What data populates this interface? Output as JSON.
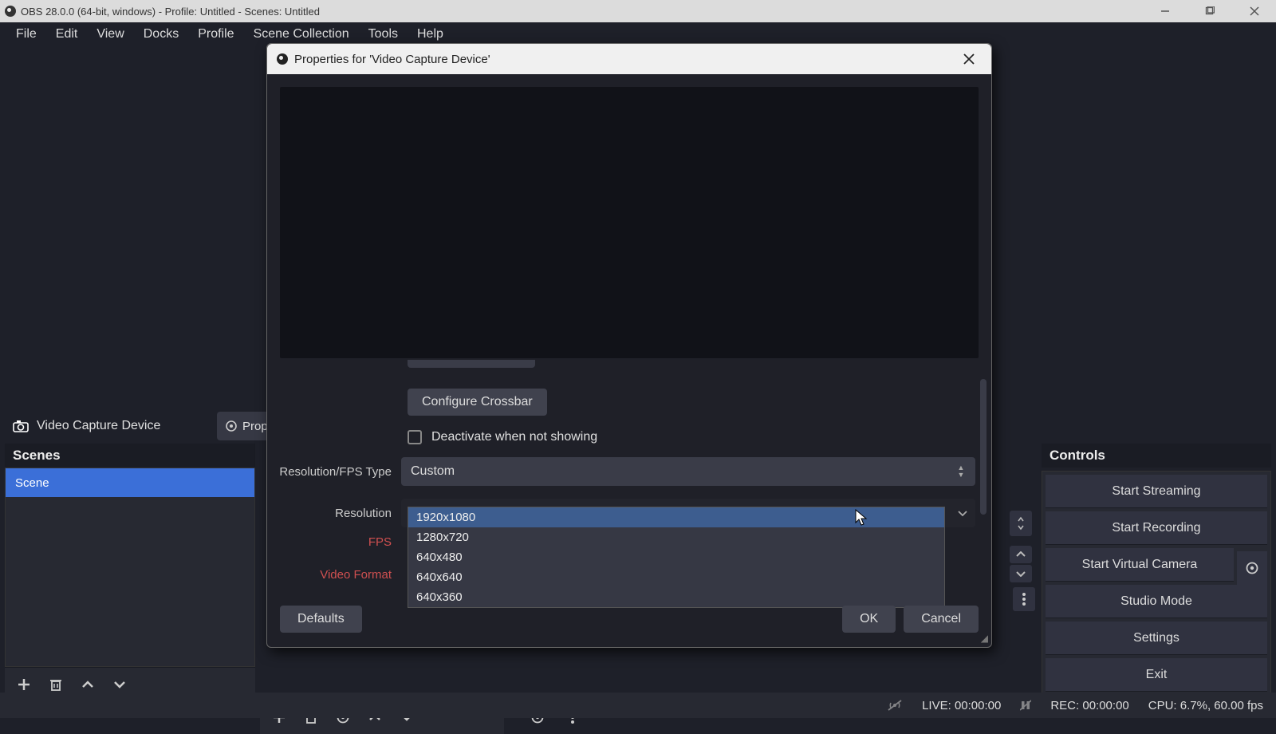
{
  "title": "OBS 28.0.0 (64-bit, windows) - Profile: Untitled - Scenes: Untitled",
  "menus": [
    "File",
    "Edit",
    "View",
    "Docks",
    "Profile",
    "Scene Collection",
    "Tools",
    "Help"
  ],
  "source_name": "Video Capture Device",
  "btn_prop": "Prop",
  "scenes_title": "Scenes",
  "scene_item": "Scene",
  "controls_title": "Controls",
  "ctrl": {
    "stream": "Start Streaming",
    "rec": "Start Recording",
    "vcam": "Start Virtual Camera",
    "studio": "Studio Mode",
    "settings": "Settings",
    "exit": "Exit"
  },
  "status": {
    "live_lbl": "LIVE:",
    "live": "00:00:00",
    "rec_lbl": "REC:",
    "rec": "00:00:00",
    "cpu": "CPU: 6.7%, 60.00 fps"
  },
  "modal": {
    "title": "Properties for 'Video Capture Device'",
    "configure": "Configure Crossbar",
    "deactivate": "Deactivate when not showing",
    "res_fps_type": "Resolution/FPS Type",
    "res_fps_val": "Custom",
    "resolution": "Resolution",
    "fps": "FPS",
    "vformat": "Video Format",
    "options": [
      "1920x1080",
      "1280x720",
      "640x480",
      "640x640",
      "640x360"
    ],
    "defaults": "Defaults",
    "ok": "OK",
    "cancel": "Cancel"
  }
}
